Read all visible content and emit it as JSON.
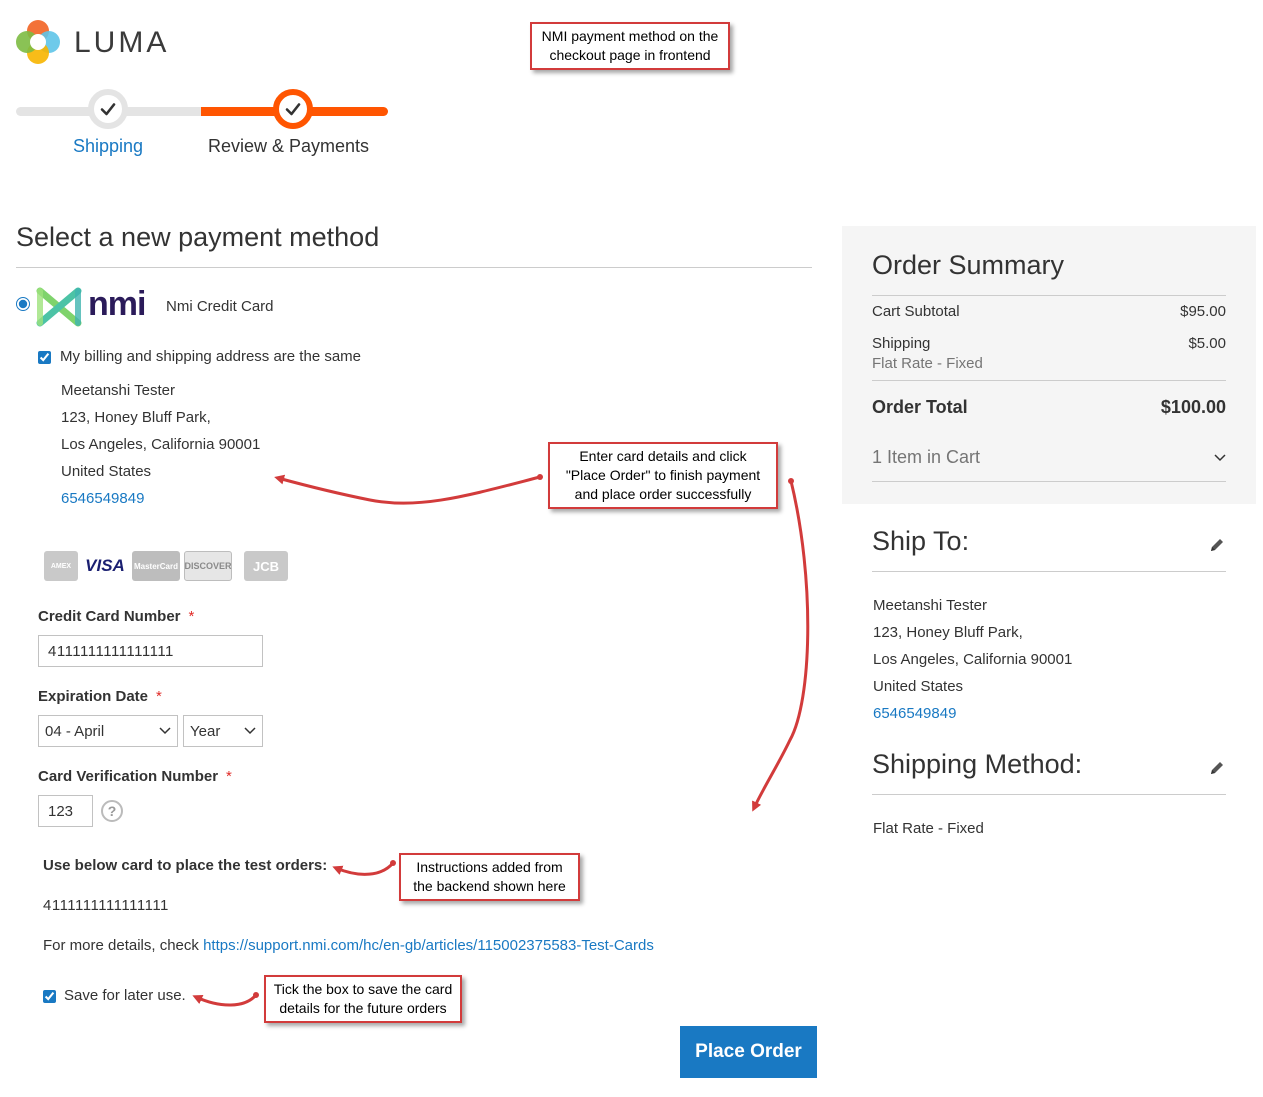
{
  "logo": {
    "text": "LUMA"
  },
  "progress": {
    "steps": [
      {
        "label": "Shipping",
        "completed": true
      },
      {
        "label": "Review & Payments",
        "completed": true,
        "active": true
      }
    ]
  },
  "annotations": {
    "top": [
      "NMI payment method on the",
      "checkout page in frontend"
    ],
    "card_details": [
      "Enter card details and click",
      "\"Place Order\" to finish payment",
      "and place order successfully"
    ],
    "instructions": [
      "Instructions added from",
      "the backend shown here"
    ],
    "save_card": [
      "Tick the box to save the card",
      "details for the future orders"
    ]
  },
  "payment": {
    "section_title": "Select a new payment method",
    "method_logo_text": "nmi",
    "method_label": "Nmi Credit Card",
    "billing_same_label": "My billing and shipping address are the same",
    "billing_same_checked": true,
    "address": {
      "name": "Meetanshi Tester",
      "street": "123, Honey Bluff Park,",
      "city_line": "Los Angeles, California 90001",
      "country": "United States",
      "phone": "6546549849"
    },
    "card_types": [
      {
        "name": "amex-icon",
        "label": "AMEX",
        "color": "#c9c9c9"
      },
      {
        "name": "visa-icon",
        "label": "VISA",
        "color": "#1a1f71"
      },
      {
        "name": "mastercard-icon",
        "label": "MasterCard",
        "color": "#bdbdbd"
      },
      {
        "name": "discover-icon",
        "label": "DISCOVER",
        "color": "#bdbdbd"
      },
      {
        "name": "jcb-icon",
        "label": "JCB",
        "color": "#c9c9c9"
      }
    ],
    "cc_number_label": "Credit Card Number",
    "cc_number_value": "4111111111111111",
    "expiration_label": "Expiration Date",
    "month_value": "04 - April",
    "year_value": "Year",
    "cvv_label": "Card Verification Number",
    "cvv_value": "123",
    "required_mark": "*",
    "help_glyph": "?",
    "instructions_title": "Use below card to place the test orders:",
    "instructions_card": "4111111111111111",
    "instructions_more_prefix": "For more details, check ",
    "instructions_link": "https://support.nmi.com/hc/en-gb/articles/115002375583-Test-Cards",
    "save_label": "Save for later use.",
    "save_checked": true,
    "place_order": "Place Order"
  },
  "summary": {
    "title": "Order Summary",
    "cart_subtotal_label": "Cart Subtotal",
    "cart_subtotal_value": "$95.00",
    "shipping_label": "Shipping",
    "shipping_value": "$5.00",
    "shipping_method": "Flat Rate - Fixed",
    "order_total_label": "Order Total",
    "order_total_value": "$100.00",
    "items_in_cart": "1 Item in Cart"
  },
  "ship_to": {
    "title": "Ship To:",
    "name": "Meetanshi Tester",
    "street": "123, Honey Bluff Park,",
    "city_line": "Los Angeles, California 90001",
    "country": "United States",
    "phone": "6546549849"
  },
  "shipping_method": {
    "title": "Shipping Method:",
    "value": "Flat Rate - Fixed"
  },
  "colors": {
    "accent": "#1979c3",
    "progress": "#ff5501",
    "annotation": "#d23b3b"
  }
}
